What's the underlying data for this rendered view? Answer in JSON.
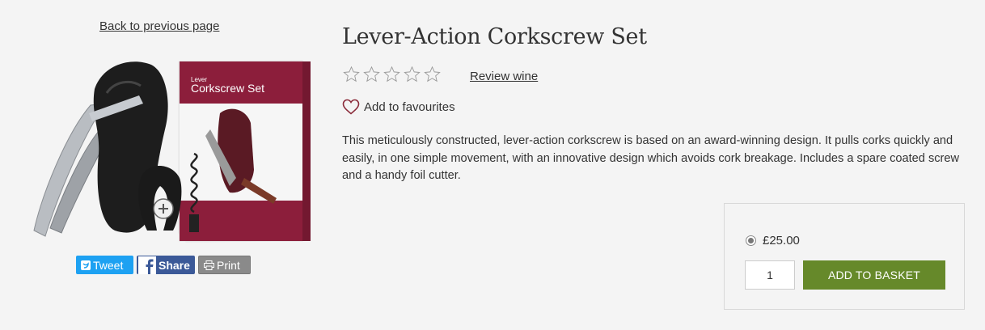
{
  "nav": {
    "back_label": "Back to previous page"
  },
  "product": {
    "title": "Lever-Action Corkscrew Set",
    "rating_stars": 0,
    "rating_max": 5,
    "review_label": "Review wine",
    "favourites_label": "Add to favourites",
    "description": "This meticulously constructed, lever-action corkscrew is based on an award-winning design. It pulls corks quickly and easily, in one simple movement, with an innovative design which avoids cork breakage. Includes a spare coated screw and a handy foil cutter.",
    "image": {
      "box_small_label": "Lever",
      "box_label": "Corkscrew Set"
    }
  },
  "share": {
    "tweet_label": "Tweet",
    "share_label": "Share",
    "print_label": "Print"
  },
  "purchase": {
    "price": "£25.00",
    "quantity": "1",
    "add_label": "ADD TO BASKET"
  },
  "colors": {
    "add_button": "#66892a",
    "tweet": "#1da1f2",
    "facebook": "#3b5998",
    "favourite_heart": "#8b2b3a"
  }
}
